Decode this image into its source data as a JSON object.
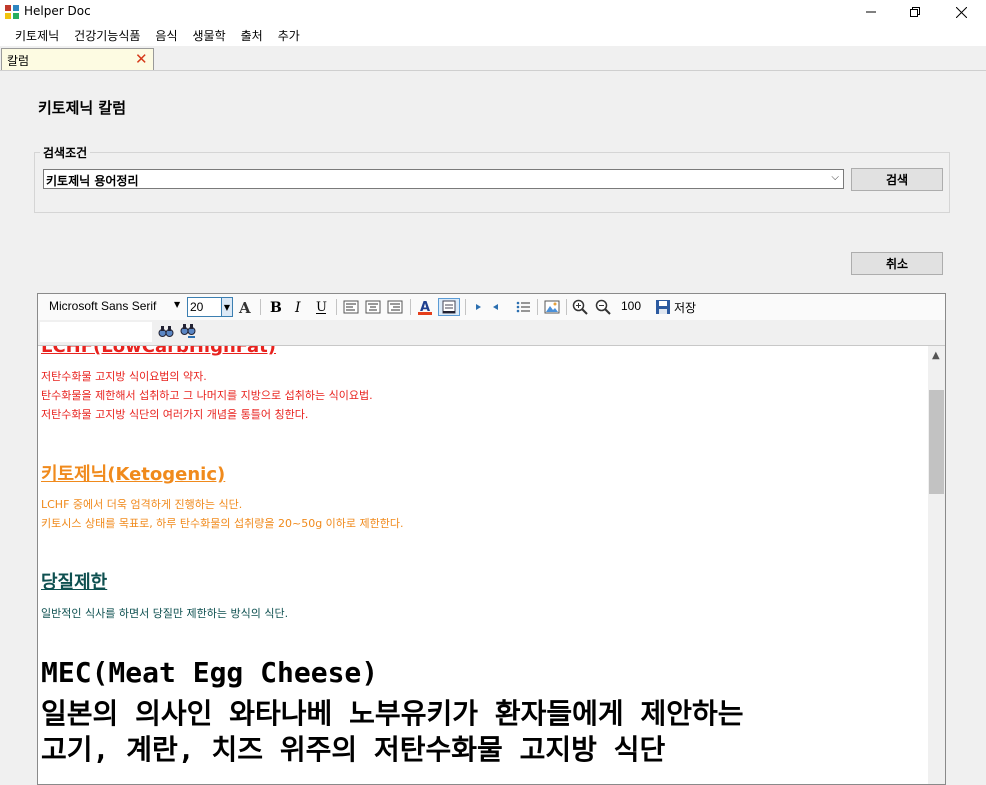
{
  "window": {
    "title": "Helper Doc"
  },
  "menu": [
    "키토제닉",
    "건강기능식품",
    "음식",
    "생물학",
    "출처",
    "추가"
  ],
  "tab": {
    "label": "칼럼"
  },
  "page": {
    "heading": "키토제닉 칼럼"
  },
  "search": {
    "group_label": "검색조건",
    "selected_value": "키토제닉 용어정리",
    "search_label": "검색",
    "cancel_label": "취소"
  },
  "toolbar": {
    "font_family": "Microsoft Sans Serif",
    "font_size": "20",
    "zoom": "100",
    "save_label": "저장"
  },
  "document": {
    "lchf": {
      "heading": "LCHF(LowCarbHighFat)",
      "color": "#e8231f",
      "lines": [
        "저탄수화물 고지방 식이요법의 약자.",
        "탄수화물을 제한해서 섭취하고 그 나머지를 지방으로 섭취하는 식이요법.",
        "저탄수화물 고지방 식단의 여러가지 개념을 통틀어 칭한다."
      ]
    },
    "keto": {
      "heading": "키토제닉(Ketogenic)",
      "color": "#f08a1c",
      "lines": [
        "LCHF 중에서 더욱 엄격하게 진행하는 식단.",
        "키토시스 상태를 목표로, 하루 탄수화물의 섭취량을 20~50g 이하로 제한한다."
      ]
    },
    "sugar": {
      "heading": "당질제한",
      "color": "#0e5050",
      "lines": [
        "일반적인 식사를 하면서 당질만 제한하는 방식의 식단."
      ]
    },
    "mec": {
      "lines": [
        "MEC(Meat Egg Cheese)",
        "일본의 의사인 와타나베 노부유키가 환자들에게 제안하는",
        "고기, 계란, 치즈 위주의 저탄수화물 고지방 식단"
      ]
    }
  }
}
